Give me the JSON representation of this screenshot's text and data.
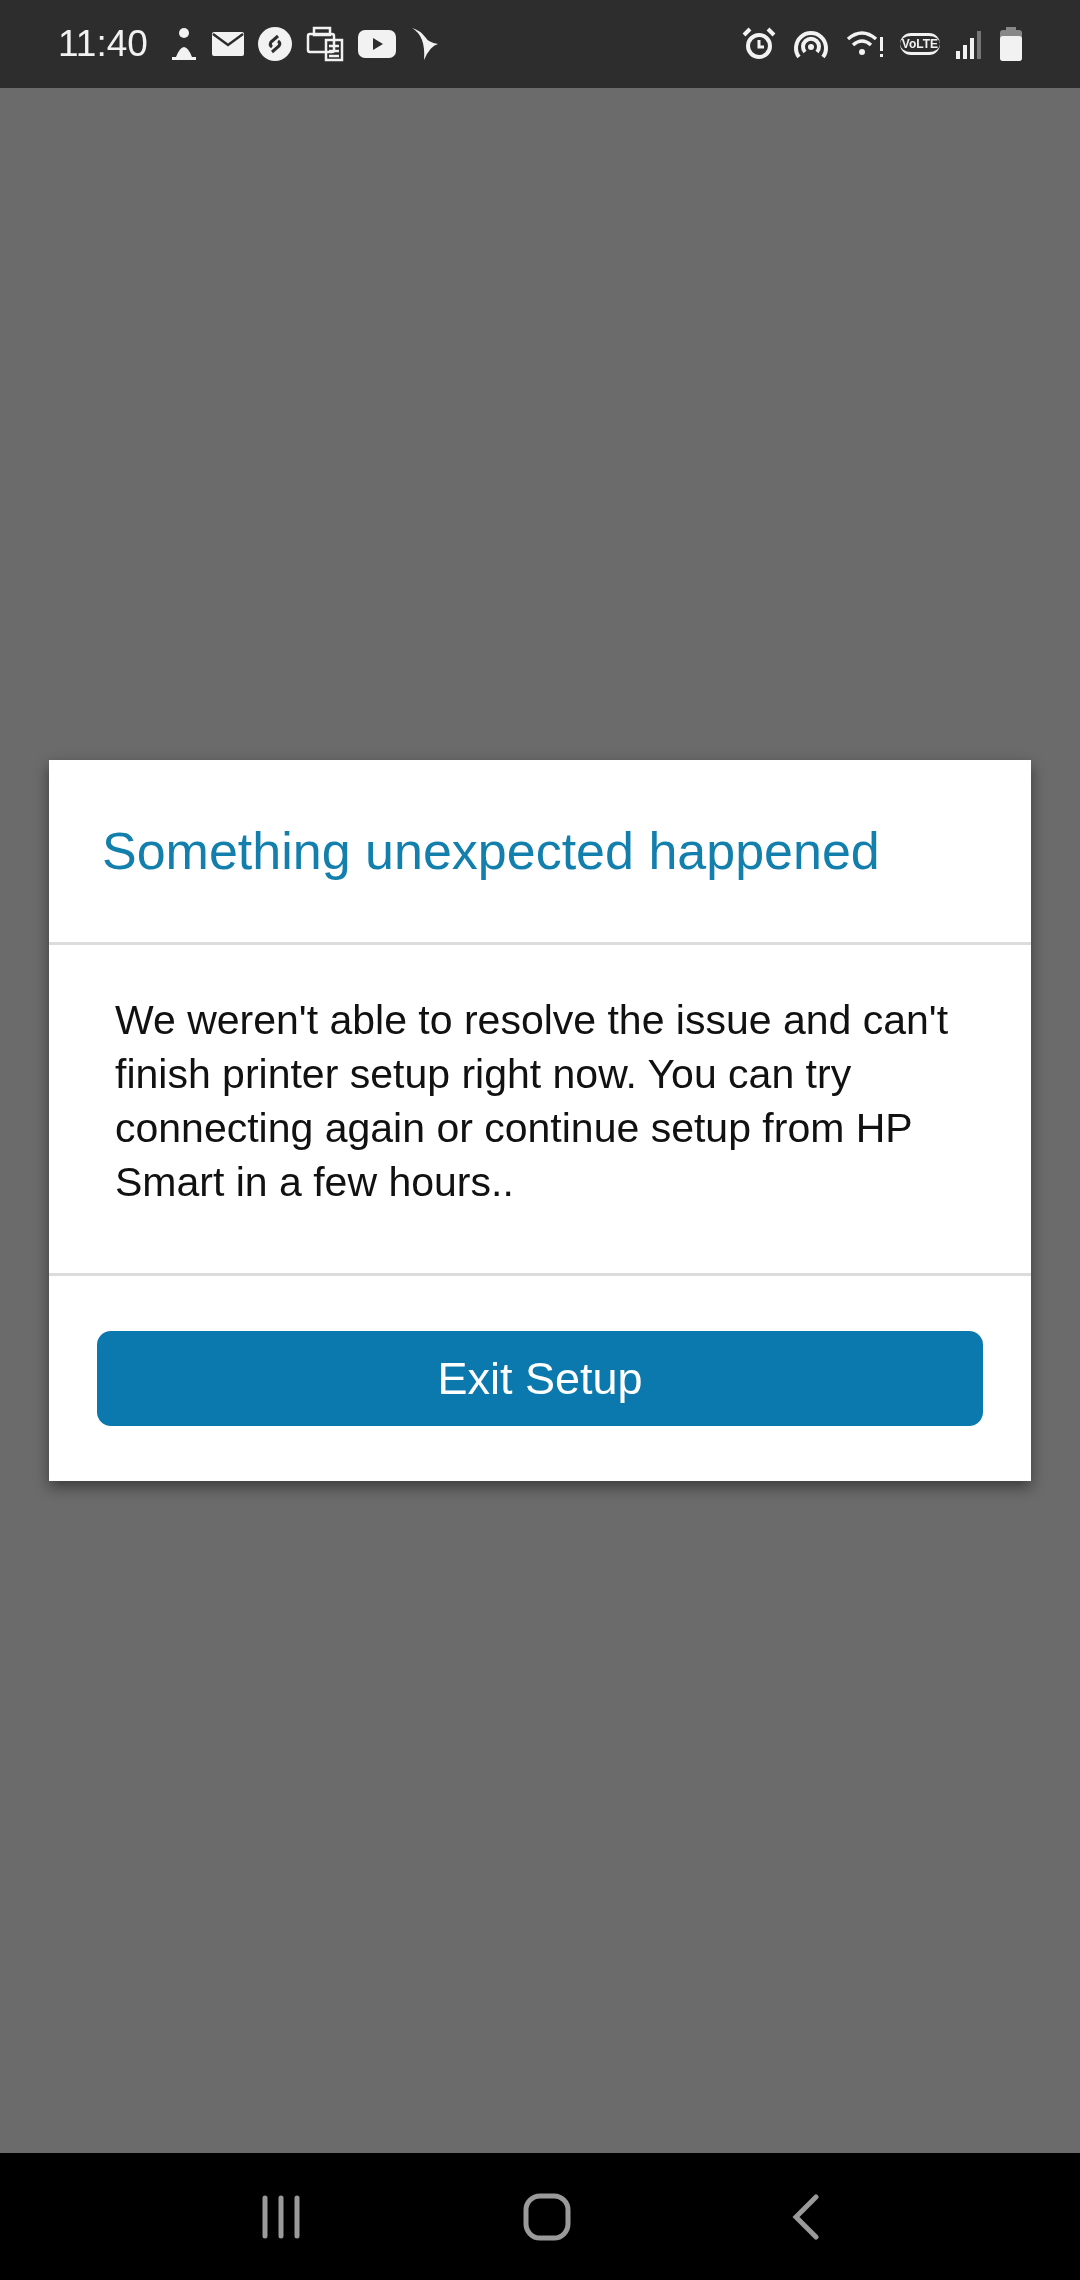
{
  "status_bar": {
    "time": "11:40",
    "volte": "VoLTE"
  },
  "dialog": {
    "title": "Something unexpected happened",
    "message": "We weren't able to resolve the issue and can't finish printer setup right now. You can try connecting again or continue setup from HP Smart in a few hours..",
    "button": "Exit Setup"
  }
}
